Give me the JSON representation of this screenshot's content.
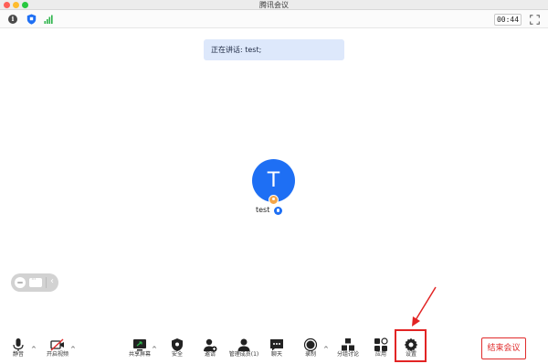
{
  "window": {
    "title": "腾讯会议"
  },
  "topbar": {
    "info_icon": "info-icon",
    "shield_icon": "shield-icon",
    "signal_icon": "signal-icon",
    "timer": "00:44",
    "fullscreen_icon": "fullscreen-icon"
  },
  "banner": {
    "text": "正在讲话: test;"
  },
  "participant": {
    "initial": "T",
    "name": "test",
    "avatar_color": "#1e6ff4",
    "host_badge_color": "#f4a64a"
  },
  "toolbar": {
    "mute": "静音",
    "video": "开启视频",
    "share": "共享屏幕",
    "security": "安全",
    "invite": "邀请",
    "members": "管理成员(1)",
    "chat": "聊天",
    "record": "录制",
    "breakout": "分组讨论",
    "apps": "应用",
    "settings": "设置",
    "end_meeting": "结束会议"
  },
  "colors": {
    "accent": "#1e6ff4",
    "danger": "#e02b2b",
    "highlight": "#e22424"
  }
}
